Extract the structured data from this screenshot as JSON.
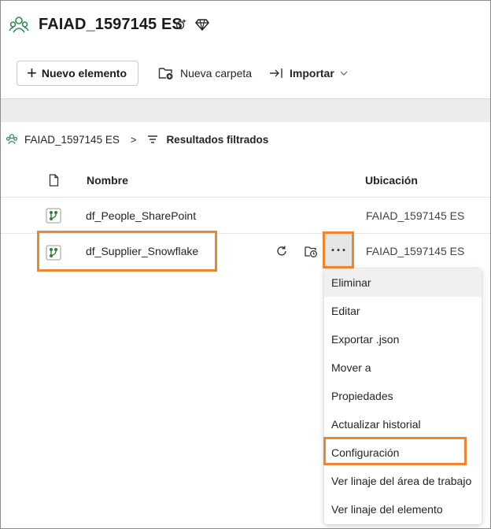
{
  "header": {
    "title": "FAIAD_1597145 ES",
    "icons": [
      "workspace-icon",
      "settings-sparkle-icon",
      "diamond-icon"
    ]
  },
  "toolbar": {
    "new_item_label": "Nuevo elemento",
    "new_folder_label": "Nueva carpeta",
    "import_label": "Importar"
  },
  "breadcrumb": {
    "workspace": "FAIAD_1597145 ES",
    "separator": ">",
    "filter_label": "Resultados filtrados"
  },
  "table": {
    "columns": {
      "name": "Nombre",
      "location": "Ubicación"
    },
    "rows": [
      {
        "name": "df_People_SharePoint",
        "location": "FAIAD_1597145 ES"
      },
      {
        "name": "df_Supplier_Snowflake",
        "location": "FAIAD_1597145 ES"
      }
    ],
    "more_label": "···"
  },
  "context_menu": {
    "items": [
      "Eliminar",
      "Editar",
      "Exportar .json",
      "Mover a",
      "Propiedades",
      "Actualizar historial",
      "Configuración",
      "Ver linaje del área de trabajo",
      "Ver linaje del elemento"
    ],
    "highlighted": "Configuración"
  },
  "colors": {
    "accent_green": "#2e8b57",
    "highlight_orange": "#f0852d",
    "dataflow_green": "#2f7d3b"
  }
}
